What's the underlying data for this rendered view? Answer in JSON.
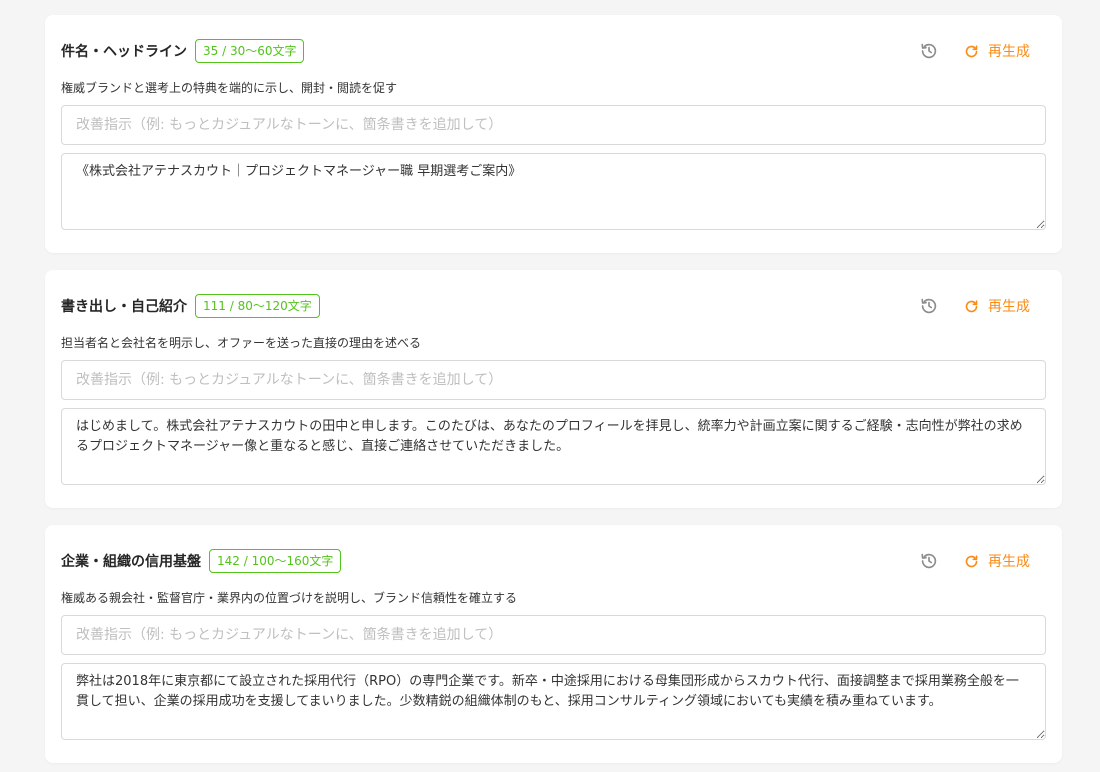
{
  "sections": [
    {
      "title": "件名・ヘッドライン",
      "count_badge": "35 / 30〜60文字",
      "description": "権威ブランドと選考上の特典を端的に示し、開封・閲読を促す",
      "instruction_placeholder": "改善指示（例: もっとカジュアルなトーンに、箇条書きを追加して）",
      "regenerate_label": "再生成",
      "body": "《株式会社アテナスカウト｜プロジェクトマネージャー職 早期選考ご案内》",
      "history_icon": "history-icon",
      "regenerate_icon": "refresh-icon"
    },
    {
      "title": "書き出し・自己紹介",
      "count_badge": "111 / 80〜120文字",
      "description": "担当者名と会社名を明示し、オファーを送った直接の理由を述べる",
      "instruction_placeholder": "改善指示（例: もっとカジュアルなトーンに、箇条書きを追加して）",
      "regenerate_label": "再生成",
      "body": "はじめまして。株式会社アテナスカウトの田中と申します。このたびは、あなたのプロフィールを拝見し、統率力や計画立案に関するご経験・志向性が弊社の求めるプロジェクトマネージャー像と重なると感じ、直接ご連絡させていただきました。",
      "history_icon": "history-icon",
      "regenerate_icon": "refresh-icon"
    },
    {
      "title": "企業・組織の信用基盤",
      "count_badge": "142 / 100〜160文字",
      "description": "権威ある親会社・監督官庁・業界内の位置づけを説明し、ブランド信頼性を確立する",
      "instruction_placeholder": "改善指示（例: もっとカジュアルなトーンに、箇条書きを追加して）",
      "regenerate_label": "再生成",
      "body": "弊社は2018年に東京都にて設立された採用代行（RPO）の専門企業です。新卒・中途採用における母集団形成からスカウト代行、面接調整まで採用業務全般を一貫して担い、企業の採用成功を支援してまいりました。少数精鋭の組織体制のもと、採用コンサルティング領域においても実績を積み重ねています。",
      "history_icon": "history-icon",
      "regenerate_icon": "refresh-icon"
    }
  ],
  "colors": {
    "badge_green": "#52c41a",
    "accent_orange": "#fa8c16",
    "icon_gray": "#8c8c8c",
    "background": "#f5f5f5"
  }
}
